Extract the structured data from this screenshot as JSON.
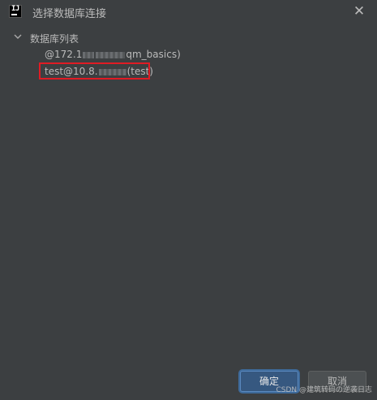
{
  "window": {
    "title": "选择数据库连接",
    "icon": "intellij-idea-icon",
    "close_glyph": "✕"
  },
  "tree": {
    "root_label": "数据库列表",
    "nodes": [
      {
        "prefix": "@172.1",
        "suffix": "qm_basics)",
        "selected": false
      },
      {
        "prefix": "test@10.8.",
        "suffix": "(test)",
        "selected": true
      }
    ]
  },
  "buttons": {
    "ok_label": "确定",
    "cancel_label": "取消"
  },
  "watermark": "CSDN @建筑转码の逆袭日志",
  "colors": {
    "background": "#3c3f41",
    "highlight_border": "#e01b24",
    "primary_button": "#365880"
  }
}
